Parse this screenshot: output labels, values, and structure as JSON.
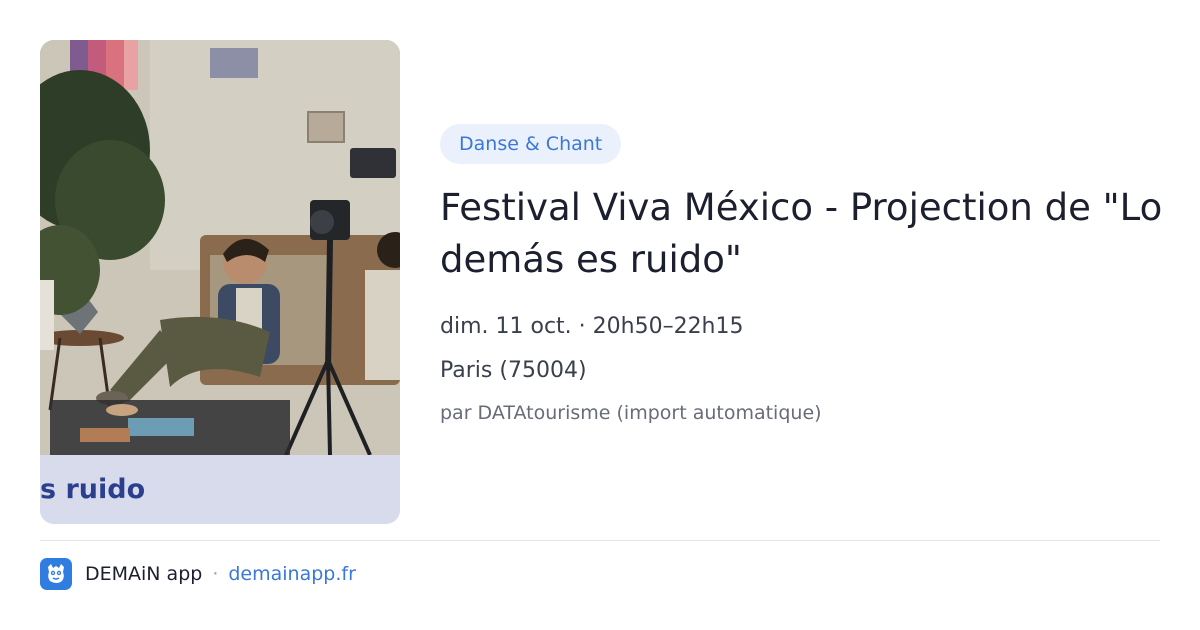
{
  "event": {
    "category": "Danse & Chant",
    "title": "Festival Viva México - Projection de \"Lo demás es ruido\"",
    "datetime": "dim. 11 oct. · 20h50–22h15",
    "location": "Paris (75004)",
    "source": "par DATAtourisme (import automatique)"
  },
  "poster": {
    "caption_fragment": "s ruido"
  },
  "footer": {
    "app_name": "DEMAiN app",
    "separator": "·",
    "domain": "demainapp.fr"
  },
  "colors": {
    "tag_background": "#eaf1fd",
    "tag_text": "#3a78d8",
    "title_text": "#1b1f2e",
    "link": "#3a78d8",
    "app_icon": "#2f7de1",
    "poster_band": "#d8dbeb",
    "poster_caption": "#2c3f8f"
  },
  "icons": {
    "app": "demain-app-icon"
  }
}
